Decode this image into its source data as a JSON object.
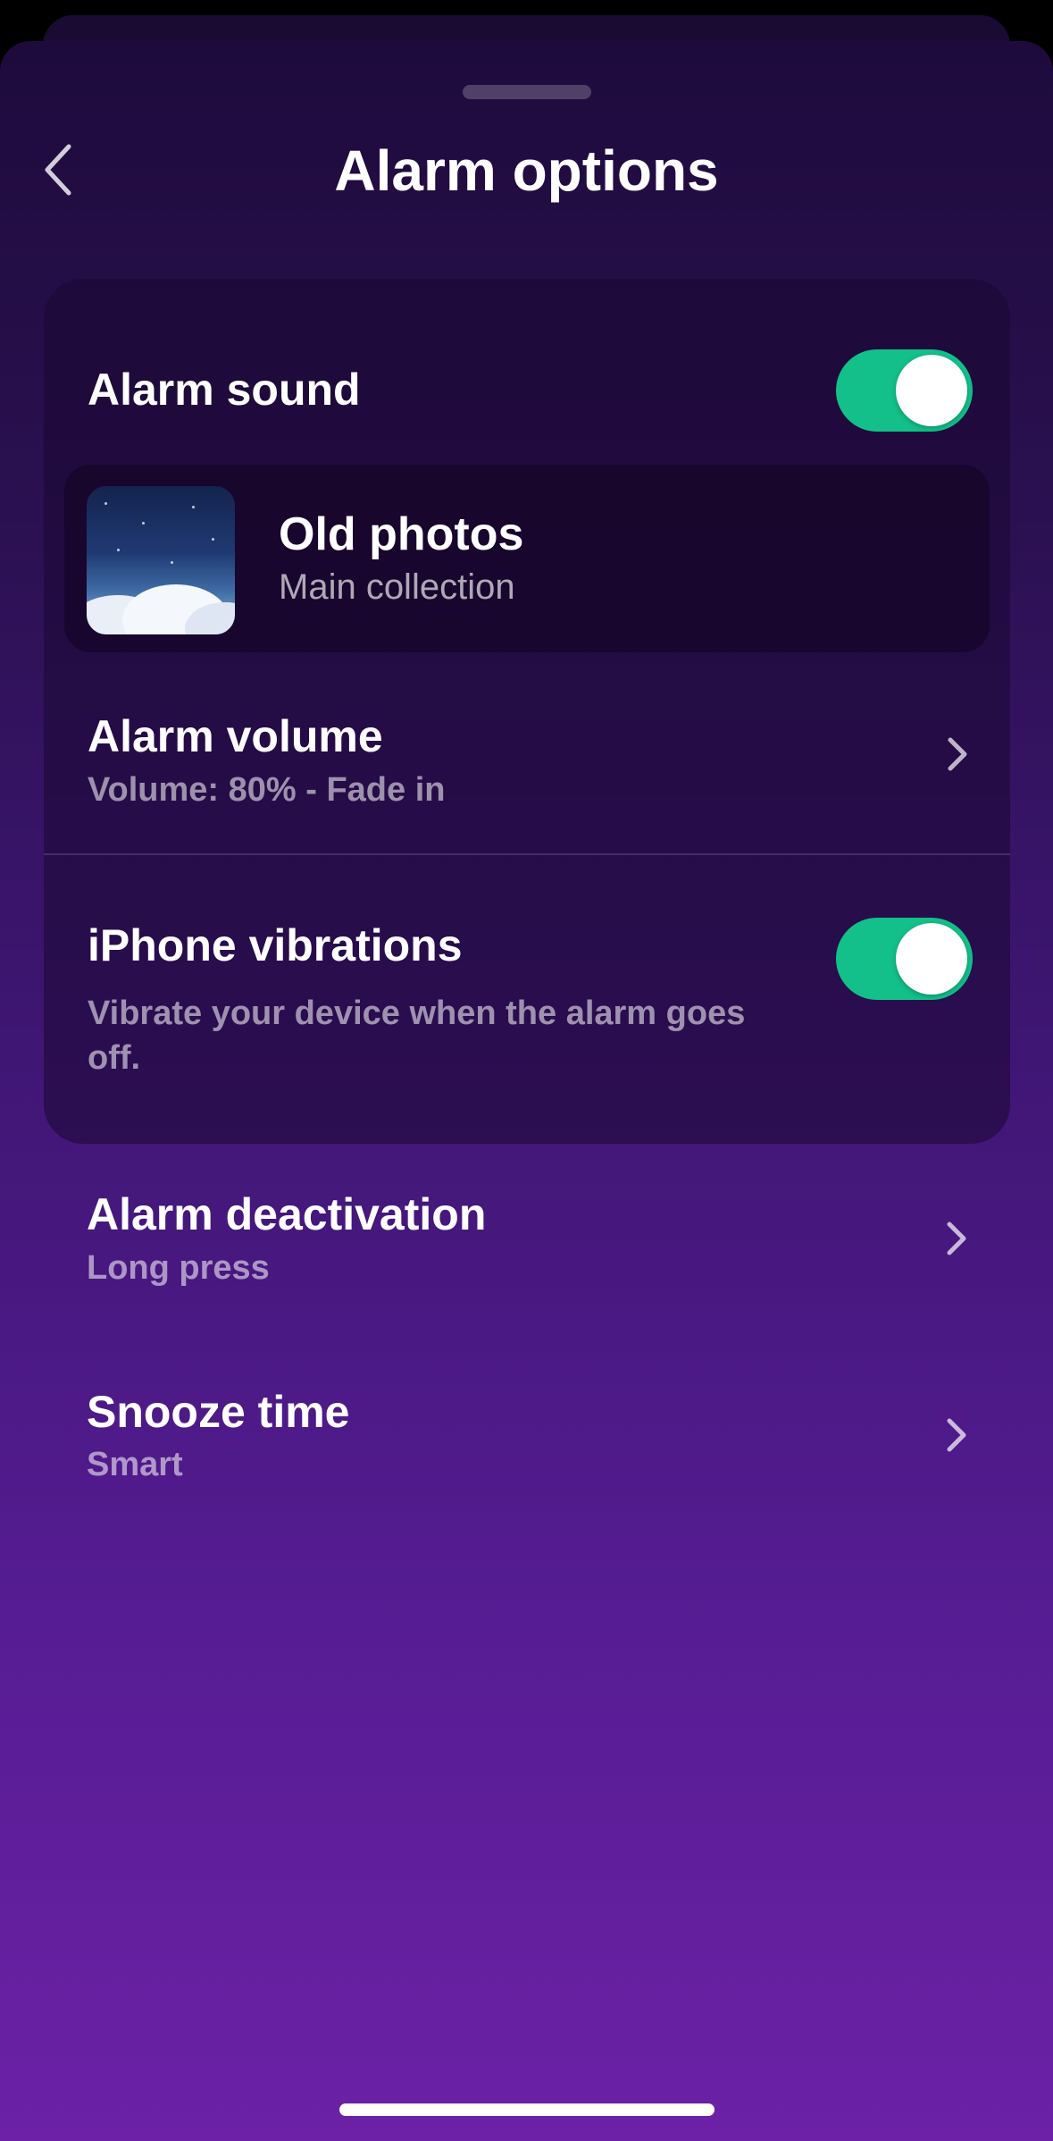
{
  "header": {
    "title": "Alarm options",
    "back_icon": "chevron-left-icon"
  },
  "alarm_sound": {
    "label": "Alarm sound",
    "enabled": true,
    "selected_sound": {
      "name": "Old photos",
      "collection": "Main collection"
    }
  },
  "alarm_volume": {
    "label": "Alarm volume",
    "detail": "Volume: 80% - Fade in"
  },
  "vibrations": {
    "label": "iPhone vibrations",
    "description": "Vibrate your device when the alarm goes off.",
    "enabled": true
  },
  "alarm_deactivation": {
    "label": "Alarm deactivation",
    "value": "Long press"
  },
  "snooze_time": {
    "label": "Snooze time",
    "value": "Smart"
  },
  "colors": {
    "toggle_on": "#13c089",
    "background_top": "#1e0b3c",
    "background_bottom": "#6c21a6"
  }
}
